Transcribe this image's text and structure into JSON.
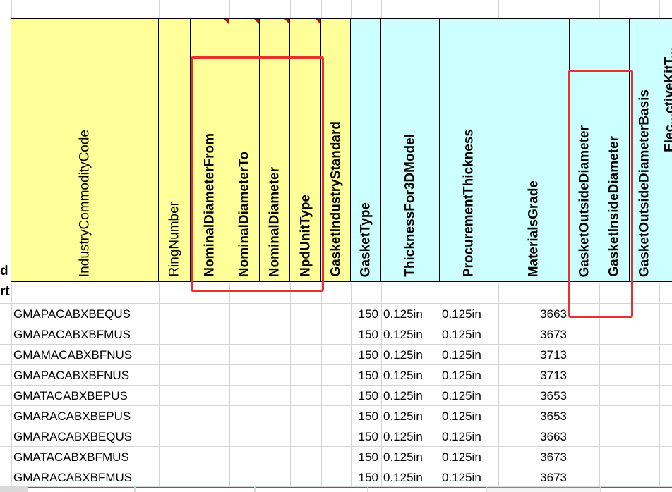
{
  "left_cut_labels": [
    "d",
    "rt"
  ],
  "headers": [
    {
      "key": "industry_commodity_code",
      "label": "IndustryCommodityCode",
      "color": "yellow"
    },
    {
      "key": "ring_number",
      "label": "RingNumber",
      "color": "yellow"
    },
    {
      "key": "nominal_diameter_from",
      "label": "NominalDiameterFrom",
      "color": "yellow",
      "bold": true,
      "flag": true
    },
    {
      "key": "nominal_diameter_to",
      "label": "NominalDiameterTo",
      "color": "yellow",
      "bold": true,
      "flag": true
    },
    {
      "key": "nominal_diameter",
      "label": "NominalDiameter",
      "color": "yellow",
      "bold": true,
      "flag": true
    },
    {
      "key": "npd_unit_type",
      "label": "NpdUnitType",
      "color": "yellow",
      "bold": true,
      "flag": true
    },
    {
      "key": "gasket_industry_standard",
      "label": "GasketIndustryStandard",
      "color": "yellow",
      "bold": true
    },
    {
      "key": "gasket_type",
      "label": "GasketType",
      "color": "cyan",
      "bold": true
    },
    {
      "key": "thickness_for_3d_model",
      "label": "ThicknessFor3DModel",
      "color": "cyan",
      "bold": true
    },
    {
      "key": "procurement_thickness",
      "label": "ProcurementThickness",
      "color": "cyan",
      "bold": true
    },
    {
      "key": "materials_grade",
      "label": "MaterialsGrade",
      "color": "cyan",
      "bold": true
    },
    {
      "key": "gasket_outside_diameter",
      "label": "GasketOutsideDiameter",
      "color": "cyan",
      "bold": true
    },
    {
      "key": "gasket_inside_diameter",
      "label": "GasketInsideDiameter",
      "color": "cyan",
      "bold": true
    },
    {
      "key": "gasket_outside_diameter_basis",
      "label": "GasketOutsideDiameterBasis",
      "color": "cyan",
      "bold": true
    },
    {
      "key": "cut_off",
      "label": "Elec...ctiveKitT...",
      "color": "cyan",
      "bold": true
    }
  ],
  "rows": [
    {
      "code": "GMAPACABXBEQUS",
      "gasket_type": "150",
      "thickness_3d": "0.125in",
      "proc_thickness": "0.125in",
      "grade": "3663"
    },
    {
      "code": "GMAPACABXBFMUS",
      "gasket_type": "150",
      "thickness_3d": "0.125in",
      "proc_thickness": "0.125in",
      "grade": "3673"
    },
    {
      "code": "GMAMACABXBFNUS",
      "gasket_type": "150",
      "thickness_3d": "0.125in",
      "proc_thickness": "0.125in",
      "grade": "3713"
    },
    {
      "code": "GMAPACABXBFNUS",
      "gasket_type": "150",
      "thickness_3d": "0.125in",
      "proc_thickness": "0.125in",
      "grade": "3713"
    },
    {
      "code": "GMATACABXBEPUS",
      "gasket_type": "150",
      "thickness_3d": "0.125in",
      "proc_thickness": "0.125in",
      "grade": "3653"
    },
    {
      "code": "GMARACABXBEPUS",
      "gasket_type": "150",
      "thickness_3d": "0.125in",
      "proc_thickness": "0.125in",
      "grade": "3653"
    },
    {
      "code": "GMARACABXBEQUS",
      "gasket_type": "150",
      "thickness_3d": "0.125in",
      "proc_thickness": "0.125in",
      "grade": "3663"
    },
    {
      "code": "GMATACABXBFMUS",
      "gasket_type": "150",
      "thickness_3d": "0.125in",
      "proc_thickness": "0.125in",
      "grade": "3673"
    },
    {
      "code": "GMARACABXBFMUS",
      "gasket_type": "150",
      "thickness_3d": "0.125in",
      "proc_thickness": "0.125in",
      "grade": "3673"
    }
  ],
  "colors": {
    "header_yellow": "#ffff99",
    "header_cyan": "#ccffff",
    "highlight_red": "#e8312f",
    "grid": "#d4d4d4"
  }
}
